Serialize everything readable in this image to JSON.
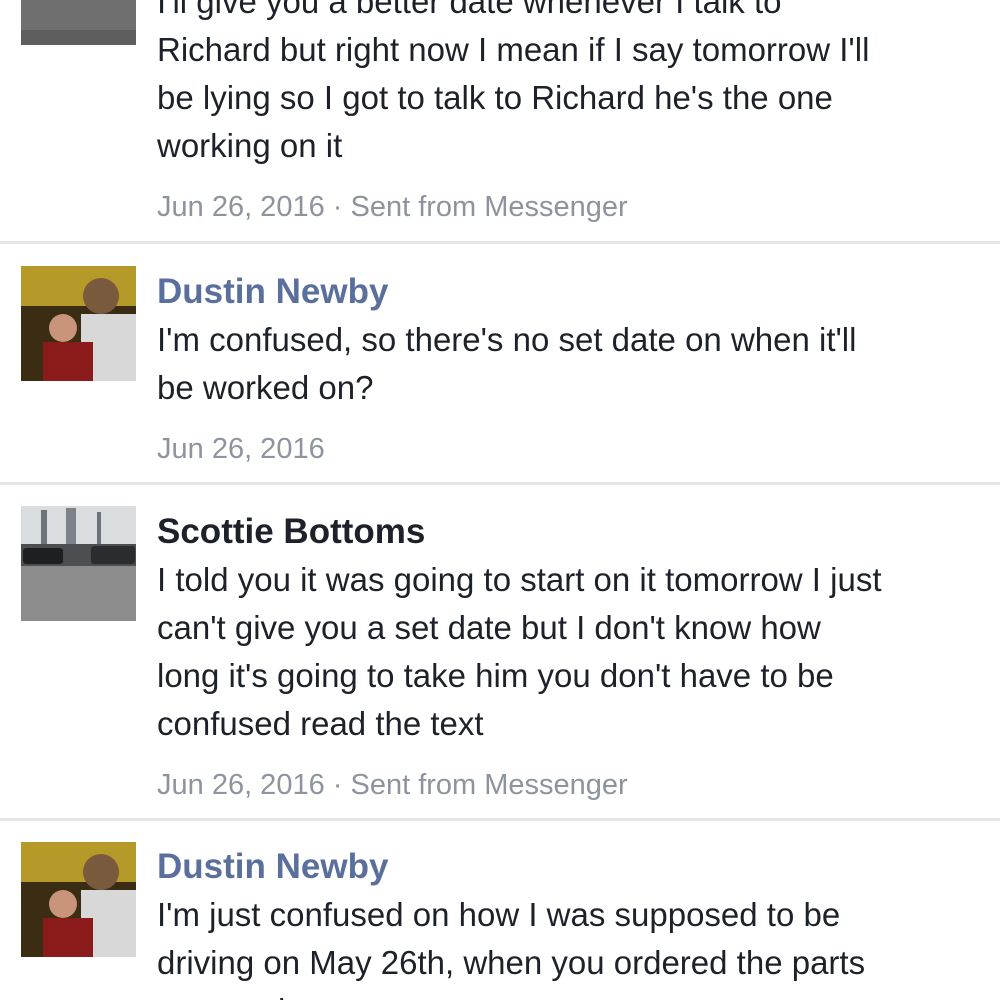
{
  "messages": [
    {
      "sender": "",
      "avatar": "scottie-bottoms-avatar",
      "lines": [
        "I'll give you a better date whenever I talk to",
        "Richard but right now I mean if I say tomorrow I'll",
        "be lying so I got to talk to Richard he's the one",
        "working on it"
      ],
      "date": "Jun 26, 2016",
      "source": "· Sent from Messenger"
    },
    {
      "sender": "Dustin Newby",
      "avatar": "dustin-newby-avatar",
      "lines": [
        "I'm confused, so there's no set date on when it'll",
        "be worked on?"
      ],
      "date": "Jun 26, 2016",
      "source": ""
    },
    {
      "sender": "Scottie Bottoms",
      "avatar": "scottie-bottoms-avatar",
      "lines": [
        "I told you it was going to start on it tomorrow I just",
        "can't give you a set date but I don't know how",
        "long it's going to take him you don't have to be",
        "confused read the text"
      ],
      "date": "Jun 26, 2016",
      "source": "· Sent from Messenger"
    },
    {
      "sender": "Dustin Newby",
      "avatar": "dustin-newby-avatar",
      "lines": [
        "I'm just confused on how I was supposed to be",
        "driving on May 26th, when you ordered the parts",
        "two weeks ago"
      ],
      "date": "",
      "source": ""
    }
  ],
  "colors": {
    "sender_blue": "#5b6f9c",
    "sender_black": "#1d2129",
    "body_text": "#1d2129",
    "meta_text": "#8d949e",
    "divider": "#e5e6e9"
  }
}
